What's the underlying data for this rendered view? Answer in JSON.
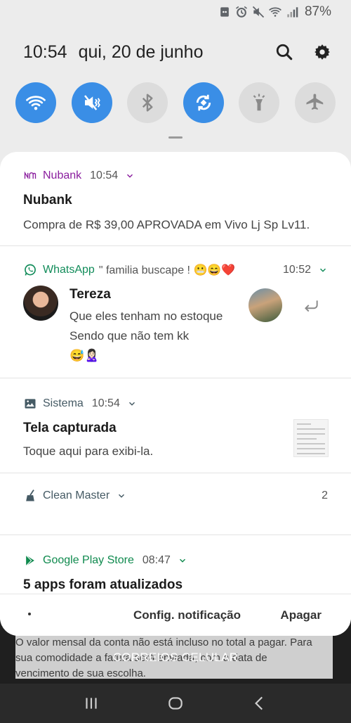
{
  "status_bar": {
    "icons": [
      "android-icon",
      "alarm-icon",
      "mute-icon",
      "wifi-icon",
      "signal-icon"
    ],
    "battery": "87%"
  },
  "header": {
    "time": "10:54",
    "date": "qui, 20 de junho",
    "icons": [
      "search-icon",
      "gear-icon"
    ]
  },
  "quick_toggles": [
    {
      "name": "wifi",
      "state": "on"
    },
    {
      "name": "sound-mute",
      "state": "on"
    },
    {
      "name": "bluetooth",
      "state": "off"
    },
    {
      "name": "auto-rotate",
      "state": "on"
    },
    {
      "name": "flashlight",
      "state": "off"
    },
    {
      "name": "airplane-mode",
      "state": "off"
    }
  ],
  "colors": {
    "accent": "#3a8ee6",
    "nubank": "#8a1d9e",
    "whatsapp": "#128c5a",
    "google_play": "#0f8a4e",
    "sistema": "#455a64"
  },
  "notifications": {
    "nubank": {
      "app": "Nubank",
      "time": "10:54",
      "title": "Nubank",
      "body": "Compra de R$ 39,00 APROVADA em Vivo Lj Sp Lv11."
    },
    "whatsapp": {
      "app": "WhatsApp",
      "group": "\" familia buscape ! 😬😄❤️",
      "time": "10:52",
      "sender": "Tereza",
      "line1": "Que eles tenham no estoque",
      "line2": "Sendo que não tem kk",
      "line3": "😅🙎🏻‍♀️"
    },
    "sistema": {
      "app": "Sistema",
      "time": "10:54",
      "title": "Tela capturada",
      "body": "Toque aqui para exibi-la."
    },
    "cleanmaster": {
      "app": "Clean Master",
      "count": "2"
    },
    "playstore": {
      "app": "Google Play Store",
      "time": "08:47",
      "title": "5 apps foram atualizados"
    }
  },
  "actions": {
    "settings": "Config. notificação",
    "clear": "Apagar"
  },
  "background": {
    "line1": "O valor mensal da conta não está incluso no total a pagar. Para",
    "line2": "sua comodidade a fatura será enviada, com a data de",
    "line3": "vencimento de sua escolha.",
    "title": "CORREIOS CELULAR"
  },
  "navbar": [
    "recents-icon",
    "home-icon",
    "back-icon"
  ]
}
